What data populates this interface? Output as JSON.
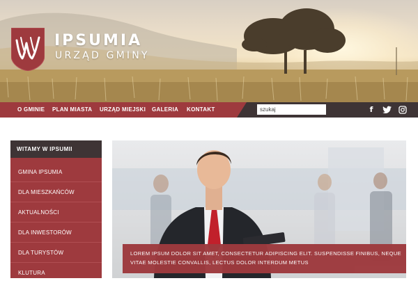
{
  "brand": {
    "name": "IPSUMIA",
    "subtitle": "URZĄD GMINY",
    "accent_color": "#9e3a3e",
    "dark_color": "#3e3435"
  },
  "nav": {
    "items": [
      "O GMINIE",
      "PLAN MIASTA",
      "URZĄD MIEJSKI",
      "GALERIA",
      "KONTAKT"
    ],
    "search_placeholder": "szukaj"
  },
  "social": {
    "facebook": "f",
    "twitter": "twitter-icon",
    "instagram": "instagram-icon"
  },
  "sidebar": {
    "title": "WITAMY W IPSUMII",
    "items": [
      "GMINA IPSUMIA",
      "DLA MIESZKAŃCÓW",
      "AKTUALNOŚCI",
      "DLA INWESTORÓW",
      "DLA TURYSTÓW",
      "KLUTURA"
    ]
  },
  "banner": {
    "caption": "LOREM IPSUM DOLOR SIT AMET, CONSECTETUR ADIPISCING ELIT. SUSPENDISSE FINIBUS, NEQUE VITAE MOLESTIE CONVALLIS, LECTUS DOLOR INTERDUM METUS"
  }
}
